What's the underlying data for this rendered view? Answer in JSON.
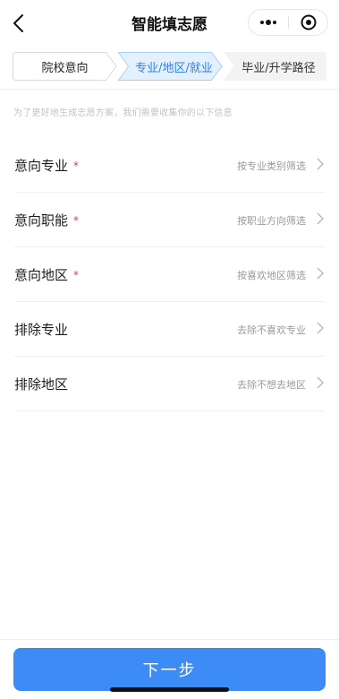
{
  "nav": {
    "title": "智能填志愿"
  },
  "steps": [
    {
      "label": "院校意向",
      "state": "inactive"
    },
    {
      "label": "专业/地区/就业",
      "state": "active"
    },
    {
      "label": "毕业/升学路径",
      "state": "inactive"
    }
  ],
  "hint": "为了更好地生成志愿方案，我们需要收集你的以下信息",
  "list": [
    {
      "label": "意向专业",
      "required": true,
      "hint": "按专业类别筛选"
    },
    {
      "label": "意向职能",
      "required": true,
      "hint": "按职业方向筛选"
    },
    {
      "label": "意向地区",
      "required": true,
      "hint": "按喜欢地区筛选"
    },
    {
      "label": "排除专业",
      "required": false,
      "hint": "去除不喜欢专业"
    },
    {
      "label": "排除地区",
      "required": false,
      "hint": "去除不想去地区"
    }
  ],
  "required_mark": "*",
  "next_button": {
    "label": "下一步"
  },
  "colors": {
    "accent": "#3d8cf5",
    "active_step_bg": "#e3f0fd",
    "active_step_text": "#2f7fe8",
    "required": "#e43a3a"
  },
  "icons": {
    "back": "chevron-left-icon",
    "more": "more-dots-icon",
    "close": "target-circle-icon",
    "row": "chevron-right-icon"
  }
}
